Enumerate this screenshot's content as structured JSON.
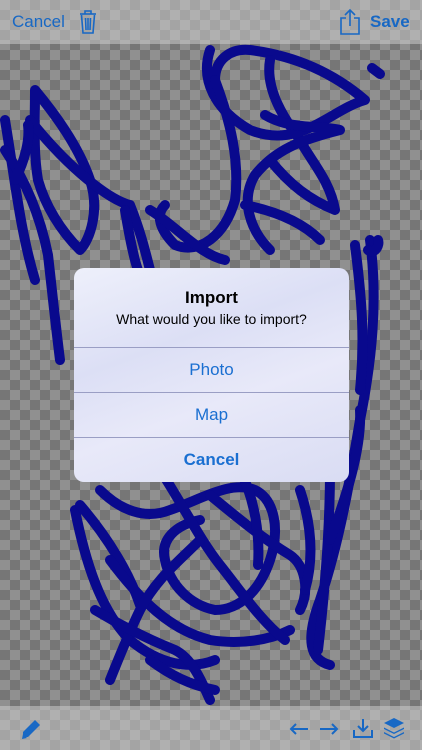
{
  "toolbar_top": {
    "cancel_label": "Cancel",
    "save_label": "Save"
  },
  "toolbar_bottom": {
    "icons": [
      "pencil-icon",
      "undo-icon",
      "redo-icon",
      "download-icon",
      "layers-icon"
    ]
  },
  "alert": {
    "title": "Import",
    "message": "What would you like to import?",
    "buttons": [
      {
        "label": "Photo"
      },
      {
        "label": "Map"
      },
      {
        "label": "Cancel"
      }
    ]
  },
  "colors": {
    "accent": "#1a6fd1",
    "ink": "#0a0a96"
  }
}
